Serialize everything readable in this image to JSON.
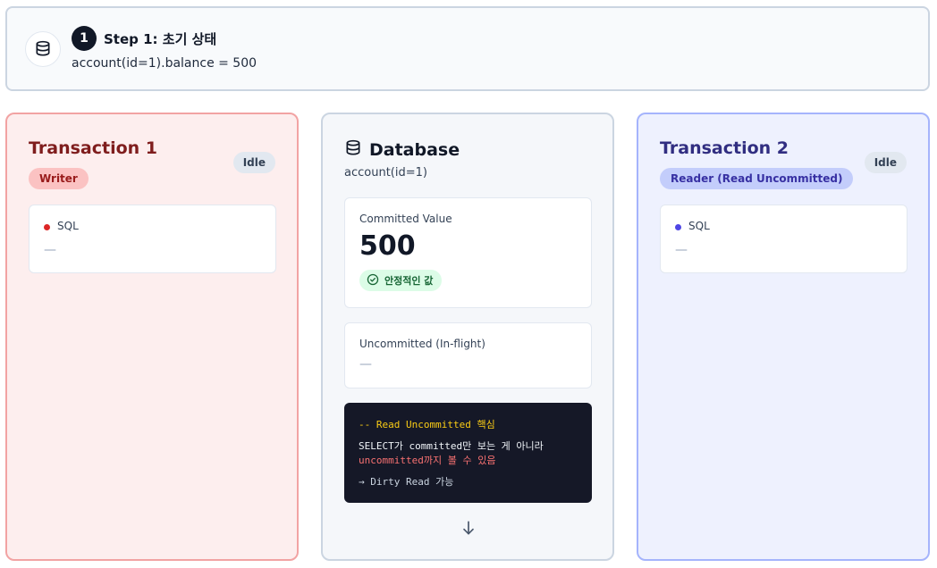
{
  "step": {
    "icon": "database-icon",
    "number": "1",
    "title": "Step 1: 초기 상태",
    "description": "account(id=1).balance = 500"
  },
  "transaction1": {
    "title": "Transaction 1",
    "role": "Writer",
    "status": "Idle",
    "sql_label": "SQL",
    "sql_value": "—",
    "accent": "#dc2626"
  },
  "database": {
    "title": "Database",
    "subtitle": "account(id=1)",
    "committed_label": "Committed Value",
    "committed_value": "500",
    "stable_badge": "안정적인 값",
    "uncommitted_label": "Uncommitted (In-flight)",
    "uncommitted_value": "—",
    "code": {
      "comment": "-- Read Uncommitted 핵심",
      "line1": "SELECT가 committed만 보는 게 아니라",
      "line2": "uncommitted까지 볼 수 있음",
      "line3": "→ Dirty Read 가능"
    }
  },
  "transaction2": {
    "title": "Transaction 2",
    "role": "Reader (Read Uncommitted)",
    "status": "Idle",
    "sql_label": "SQL",
    "sql_value": "—",
    "accent": "#4f46e5"
  }
}
